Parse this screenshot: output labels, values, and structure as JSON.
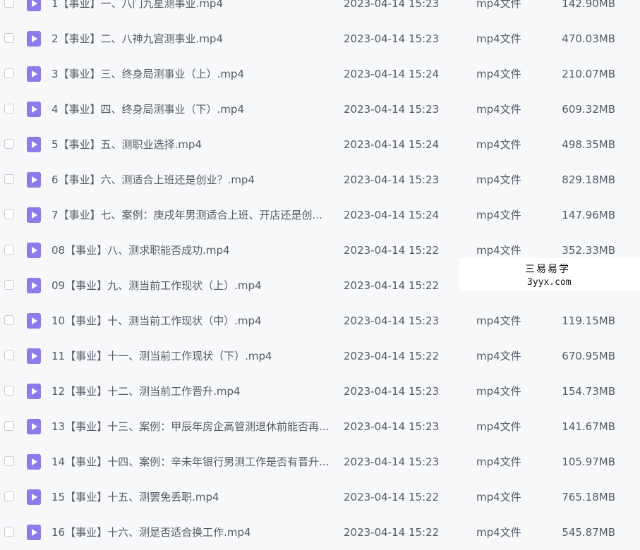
{
  "files": [
    {
      "name": "1【事业】一、八门九星测事业.mp4",
      "date": "2023-04-14 15:23",
      "type": "mp4文件",
      "size": "142.90MB"
    },
    {
      "name": "2【事业】二、八神九宫测事业.mp4",
      "date": "2023-04-14 15:23",
      "type": "mp4文件",
      "size": "470.03MB"
    },
    {
      "name": "3【事业】三、终身局测事业（上）.mp4",
      "date": "2023-04-14 15:24",
      "type": "mp4文件",
      "size": "210.07MB"
    },
    {
      "name": "4【事业】四、终身局测事业（下）.mp4",
      "date": "2023-04-14 15:23",
      "type": "mp4文件",
      "size": "609.32MB"
    },
    {
      "name": "5【事业】五、测职业选择.mp4",
      "date": "2023-04-14 15:24",
      "type": "mp4文件",
      "size": "498.35MB"
    },
    {
      "name": "6【事业】六、测适合上班还是创业？.mp4",
      "date": "2023-04-14 15:23",
      "type": "mp4文件",
      "size": "829.18MB"
    },
    {
      "name": "7【事业】七、案例：庚戌年男测适合上班、开店还是创...",
      "date": "2023-04-14 15:24",
      "type": "mp4文件",
      "size": "147.96MB"
    },
    {
      "name": "08【事业】八、测求职能否成功.mp4",
      "date": "2023-04-14 15:22",
      "type": "mp4文件",
      "size": "352.33MB"
    },
    {
      "name": "09【事业】九、测当前工作现状（上）.mp4",
      "date": "2023-04-14 15:22",
      "type": "mp4文件",
      "size": ""
    },
    {
      "name": "10【事业】十、测当前工作现状（中）.mp4",
      "date": "2023-04-14 15:23",
      "type": "mp4文件",
      "size": "119.15MB"
    },
    {
      "name": "11【事业】十一、测当前工作现状（下）.mp4",
      "date": "2023-04-14 15:22",
      "type": "mp4文件",
      "size": "670.95MB"
    },
    {
      "name": "12【事业】十二、测当前工作晋升.mp4",
      "date": "2023-04-14 15:23",
      "type": "mp4文件",
      "size": "154.73MB"
    },
    {
      "name": "13【事业】十三、案例：甲辰年房企高管测退休前能否再...",
      "date": "2023-04-14 15:23",
      "type": "mp4文件",
      "size": "141.67MB"
    },
    {
      "name": "14【事业】十四、案例：辛未年银行男测工作是否有晋升...",
      "date": "2023-04-14 15:23",
      "type": "mp4文件",
      "size": "105.97MB"
    },
    {
      "name": "15【事业】十五、测罢免丢职.mp4",
      "date": "2023-04-14 15:22",
      "type": "mp4文件",
      "size": "765.18MB"
    },
    {
      "name": "16【事业】十六、测是否适合换工作.mp4",
      "date": "2023-04-14 15:22",
      "type": "mp4文件",
      "size": "545.87MB"
    }
  ],
  "watermark": {
    "line1": "三易易学",
    "line2": "3yyx.com"
  },
  "colors": {
    "file_icon": "#8c7be8",
    "background": "#f7f8fa",
    "text": "#555a66"
  }
}
